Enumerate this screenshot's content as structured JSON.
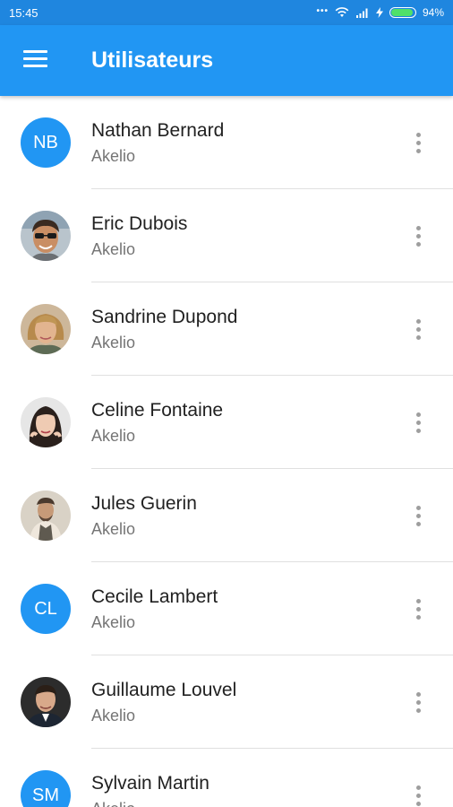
{
  "status_bar": {
    "time": "15:45",
    "battery": "94%",
    "battery_level": 0.94,
    "icons": [
      "more-dots-icon",
      "wifi-icon",
      "signal-icon",
      "charging-icon",
      "battery-icon"
    ]
  },
  "app_bar": {
    "title": "Utilisateurs",
    "menu_icon": "hamburger-menu-icon",
    "color": "#2196f3"
  },
  "users": [
    {
      "name": "Nathan Bernard",
      "company": "Akelio",
      "initials": "NB",
      "avatar": "initials"
    },
    {
      "name": "Eric Dubois",
      "company": "Akelio",
      "avatar": "photo"
    },
    {
      "name": "Sandrine Dupond",
      "company": "Akelio",
      "avatar": "photo"
    },
    {
      "name": "Celine Fontaine",
      "company": "Akelio",
      "avatar": "photo"
    },
    {
      "name": "Jules Guerin",
      "company": "Akelio",
      "avatar": "photo"
    },
    {
      "name": "Cecile Lambert",
      "company": "Akelio",
      "initials": "CL",
      "avatar": "initials"
    },
    {
      "name": "Guillaume Louvel",
      "company": "Akelio",
      "avatar": "photo"
    },
    {
      "name": "Sylvain Martin",
      "company": "Akelio",
      "initials": "SM",
      "avatar": "initials"
    }
  ],
  "row_action_icon": "more-vertical-icon"
}
